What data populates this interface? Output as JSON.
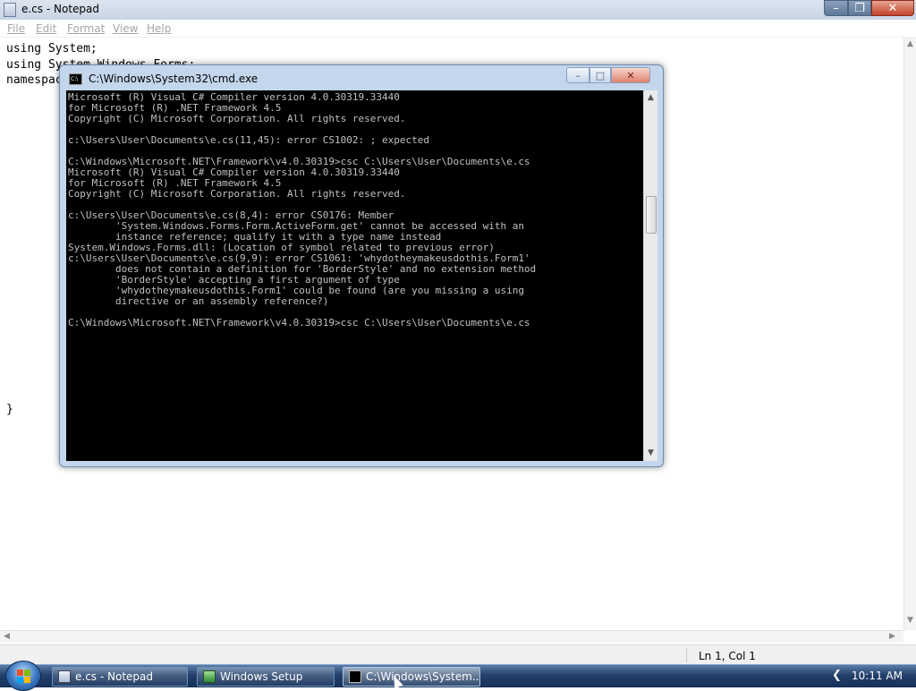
{
  "notepad": {
    "title": "e.cs - Notepad",
    "menu": [
      "File",
      "Edit",
      "Format",
      "View",
      "Help"
    ],
    "editor_text": "using System;\nusing System.Windows.Forms;\nnamespace\n\n\n\n\n\n\n\n\n\n\n\n\n\n\n\n\n\n\n\n\n}",
    "status": "Ln 1, Col 1",
    "caption_buttons": {
      "minimize": "minimize-icon",
      "maximize": "restore-icon",
      "close": "close-icon"
    }
  },
  "cmd": {
    "title": "C:\\Windows\\System32\\cmd.exe",
    "icon_text": "C:\\",
    "output": "Microsoft (R) Visual C# Compiler version 4.0.30319.33440\nfor Microsoft (R) .NET Framework 4.5\nCopyright (C) Microsoft Corporation. All rights reserved.\n\nc:\\Users\\User\\Documents\\e.cs(11,45): error CS1002: ; expected\n\nC:\\Windows\\Microsoft.NET\\Framework\\v4.0.30319>csc C:\\Users\\User\\Documents\\e.cs\nMicrosoft (R) Visual C# Compiler version 4.0.30319.33440\nfor Microsoft (R) .NET Framework 4.5\nCopyright (C) Microsoft Corporation. All rights reserved.\n\nc:\\Users\\User\\Documents\\e.cs(8,4): error CS0176: Member\n        'System.Windows.Forms.Form.ActiveForm.get' cannot be accessed with an\n        instance reference; qualify it with a type name instead\nSystem.Windows.Forms.dll: (Location of symbol related to previous error)\nc:\\Users\\User\\Documents\\e.cs(9,9): error CS1061: 'whydotheymakeusdothis.Form1'\n        does not contain a definition for 'BorderStyle' and no extension method\n        'BorderStyle' accepting a first argument of type\n        'whydotheymakeusdothis.Form1' could be found (are you missing a using\n        directive or an assembly reference?)\n\nC:\\Windows\\Microsoft.NET\\Framework\\v4.0.30319>csc C:\\Users\\User\\Documents\\e.cs",
    "caption_buttons": {
      "minimize": "minimize-icon",
      "maximize": "maximize-icon",
      "close": "close-icon"
    }
  },
  "taskbar": {
    "buttons": [
      {
        "label": "e.cs - Notepad",
        "icon": "notepad-icon"
      },
      {
        "label": "Windows Setup",
        "icon": "setup-icon"
      },
      {
        "label": "C:\\Windows\\System...",
        "icon": "cmd-icon",
        "active": true
      }
    ],
    "clock": "10:11 AM"
  },
  "colors": {
    "console_bg": "#000000",
    "console_fg": "#c0c0c0",
    "taskbar": "#23406a"
  }
}
